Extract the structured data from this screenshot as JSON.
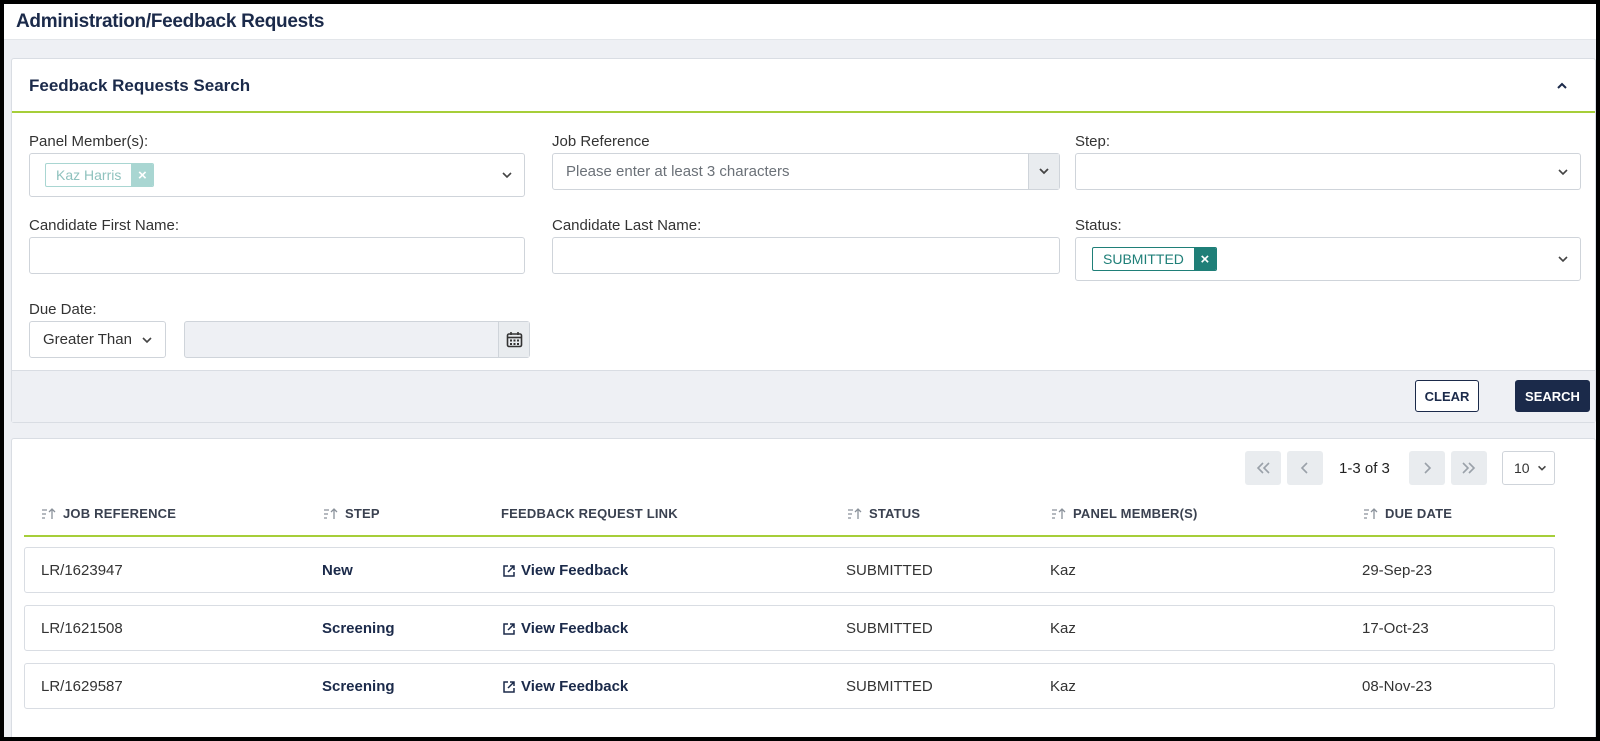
{
  "page": {
    "title": "Administration/Feedback Requests"
  },
  "search": {
    "title": "Feedback Requests Search",
    "panel_members_label": "Panel Member(s):",
    "panel_members_tags": [
      "Kaz Harris"
    ],
    "job_reference_label": "Job Reference",
    "job_reference_placeholder": "Please enter at least 3 characters",
    "step_label": "Step:",
    "first_name_label": "Candidate First Name:",
    "last_name_label": "Candidate Last Name:",
    "status_label": "Status:",
    "status_tags": [
      "SUBMITTED"
    ],
    "due_date_label": "Due Date:",
    "due_date_operator": "Greater Than",
    "clear_label": "CLEAR",
    "search_label": "SEARCH"
  },
  "results": {
    "pagination_info": "1-3 of 3",
    "page_size": "10",
    "columns": [
      "JOB REFERENCE",
      "STEP",
      "FEEDBACK REQUEST LINK",
      "STATUS",
      "PANEL MEMBER(S)",
      "DUE DATE"
    ],
    "rows": [
      {
        "job_reference": "LR/1623947",
        "step": "New",
        "link": "View Feedback",
        "status": "SUBMITTED",
        "panel_members": "Kaz",
        "due_date": "29-Sep-23"
      },
      {
        "job_reference": "LR/1621508",
        "step": "Screening",
        "link": "View Feedback",
        "status": "SUBMITTED",
        "panel_members": "Kaz",
        "due_date": "17-Oct-23"
      },
      {
        "job_reference": "LR/1629587",
        "step": "Screening",
        "link": "View Feedback",
        "status": "SUBMITTED",
        "panel_members": "Kaz",
        "due_date": "08-Nov-23"
      }
    ]
  },
  "colors": {
    "accent": "#a6ce39",
    "navy": "#1b2a4a",
    "teal": "#1f7f78"
  },
  "icons": [
    "chevron-up-icon",
    "chevron-down-icon",
    "close-icon",
    "calendar-icon",
    "sort-icon",
    "external-link-icon",
    "first-page-icon",
    "previous-page-icon",
    "next-page-icon",
    "last-page-icon"
  ]
}
